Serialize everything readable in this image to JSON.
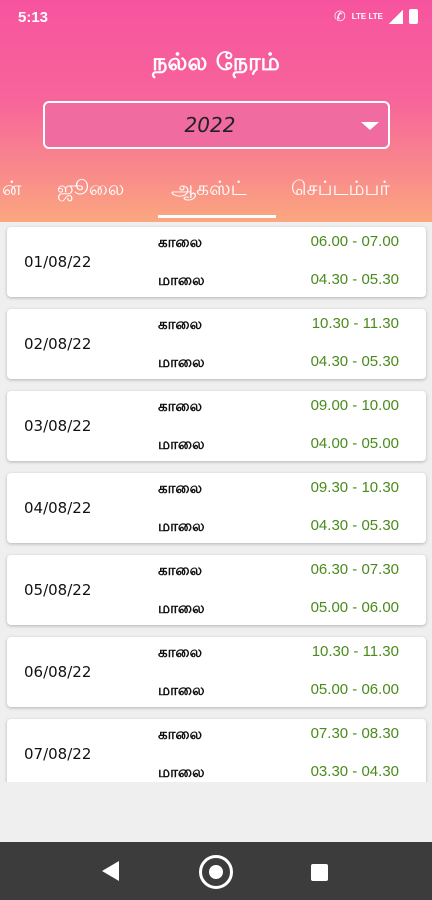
{
  "status_bar": {
    "time": "5:13",
    "network": "LTE LTE"
  },
  "header": {
    "title": "நல்ல நேரம்"
  },
  "year_select": {
    "value": "2022"
  },
  "tabs": [
    {
      "label": "ன்"
    },
    {
      "label": "ஜூலை"
    },
    {
      "label": "ஆகஸ்ட்",
      "selected": true
    },
    {
      "label": "செப்டம்பர்"
    }
  ],
  "labels": {
    "morning": "காலை",
    "evening": "மாலை"
  },
  "entries": [
    {
      "date": "01/08/22",
      "morning": "06.00 - 07.00",
      "evening": "04.30 - 05.30"
    },
    {
      "date": "02/08/22",
      "morning": "10.30 - 11.30",
      "evening": "04.30 - 05.30"
    },
    {
      "date": "03/08/22",
      "morning": "09.00 - 10.00",
      "evening": "04.00 - 05.00"
    },
    {
      "date": "04/08/22",
      "morning": "09.30 - 10.30",
      "evening": "04.30 - 05.30"
    },
    {
      "date": "05/08/22",
      "morning": "06.30 - 07.30",
      "evening": "05.00 - 06.00"
    },
    {
      "date": "06/08/22",
      "morning": "10.30 - 11.30",
      "evening": "05.00 - 06.00"
    },
    {
      "date": "07/08/22",
      "morning": "07.30 - 08.30",
      "evening": "03.30 - 04.30"
    }
  ],
  "colors": {
    "accent": "#f7549f",
    "time_text": "#4a8a1c",
    "navbar": "#3c3c3c"
  }
}
